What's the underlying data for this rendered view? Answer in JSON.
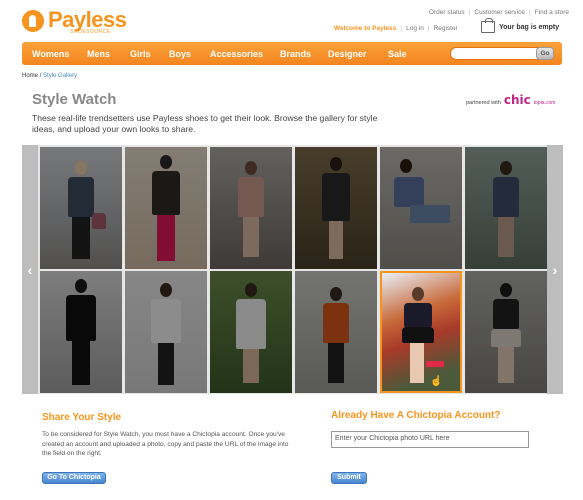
{
  "brand": {
    "name": "Payless",
    "tagline": "SHOESOURCE",
    "accent": "#f7941d"
  },
  "utility_links": [
    "Order status",
    "Customer service",
    "Find a store"
  ],
  "account": {
    "welcome": "Welcome to Payless",
    "login": "Log in",
    "register": "Register",
    "bag": "Your bag is empty"
  },
  "nav": {
    "items": [
      "Womens",
      "Mens",
      "Girls",
      "Boys",
      "Accessories",
      "Brands",
      "Designer",
      "Sale"
    ],
    "search_placeholder": "",
    "go_label": "Go"
  },
  "breadcrumb": {
    "home": "Home",
    "separator": "/",
    "current": "Style Gallery"
  },
  "page": {
    "title": "Style Watch",
    "partner_label": "partnered with",
    "partner_brand": "chic",
    "partner_sub": "topia.com",
    "intro": "These real-life trendsetters use Payless shoes to get their look.  Browse the gallery for style ideas, and upload your own looks to share."
  },
  "gallery": {
    "prev_icon": "chevron-left-icon",
    "next_icon": "chevron-right-icon",
    "prev_glyph": "‹",
    "next_glyph": "›",
    "active_index": 10,
    "count": 12
  },
  "share": {
    "title": "Share Your Style",
    "description": "To be considered for Style Watch, you must have a Chictopia account. Once you've created an account and uploaded a photo, copy and paste the URL of the image into the field on the right.",
    "button": "Go To Chictopia"
  },
  "chictopia": {
    "title": "Already Have A Chictopia Account?",
    "placeholder": "Enter your Chictopia photo URL here",
    "submit": "Submit"
  }
}
